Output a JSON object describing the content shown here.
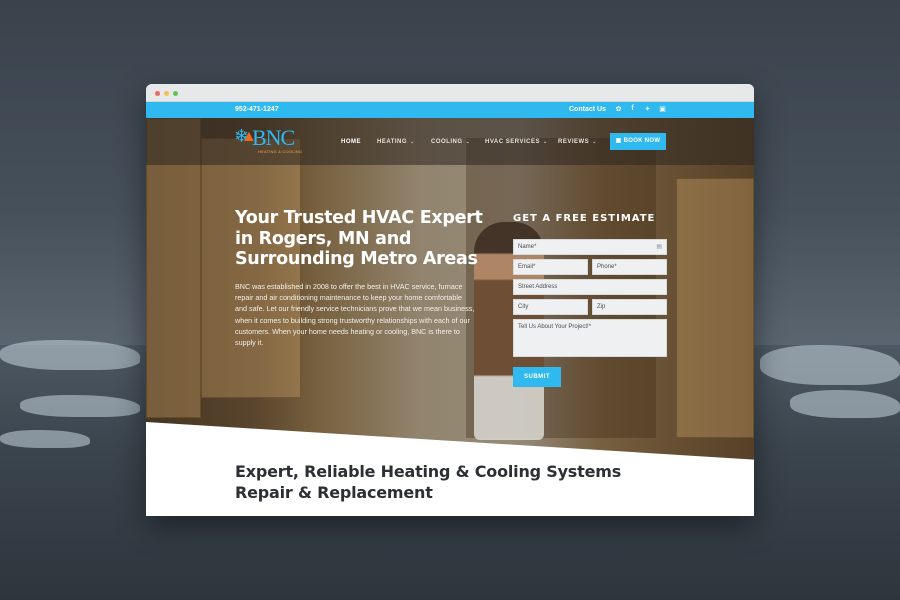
{
  "topbar": {
    "phone": "952-471-1247",
    "contact_label": "Contact Us",
    "social_icons": [
      "yelp-icon",
      "facebook-icon",
      "twitter-icon",
      "instagram-icon"
    ]
  },
  "logo": {
    "brand": "BNC",
    "tagline": "HEATING & COOLING"
  },
  "nav": {
    "home": "HOME",
    "heating": "HEATING",
    "cooling": "COOLING",
    "hvac_services": "HVAC SERVICES",
    "reviews": "REVIEWS",
    "book_now": "BOOK NOW"
  },
  "hero": {
    "headline": "Your Trusted HVAC Expert in Rogers, MN and Surrounding Metro Areas",
    "intro": "BNC was established in 2008 to offer the best in HVAC service, furnace repair and air conditioning maintenance to keep your home comfortable and safe. Let our friendly service technicians prove that we mean business, when it comes to building strong trustworthy relationships with each of our customers. When your home needs heating or cooling, BNC is there to supply it."
  },
  "estimate_form": {
    "title": "GET A FREE ESTIMATE",
    "name_placeholder": "Name*",
    "email_placeholder": "Email*",
    "phone_placeholder": "Phone*",
    "street_placeholder": "Street Address",
    "city_placeholder": "City",
    "zip_placeholder": "Zip",
    "project_placeholder": "Tell Us About Your Project!*",
    "submit_label": "SUBMIT"
  },
  "section": {
    "title": "Expert, Reliable Heating & Cooling Systems Repair & Replacement"
  },
  "colors": {
    "accent": "#2fb9ef",
    "logo_flame": "#e96a22",
    "heading_dark": "#2c2f33"
  }
}
